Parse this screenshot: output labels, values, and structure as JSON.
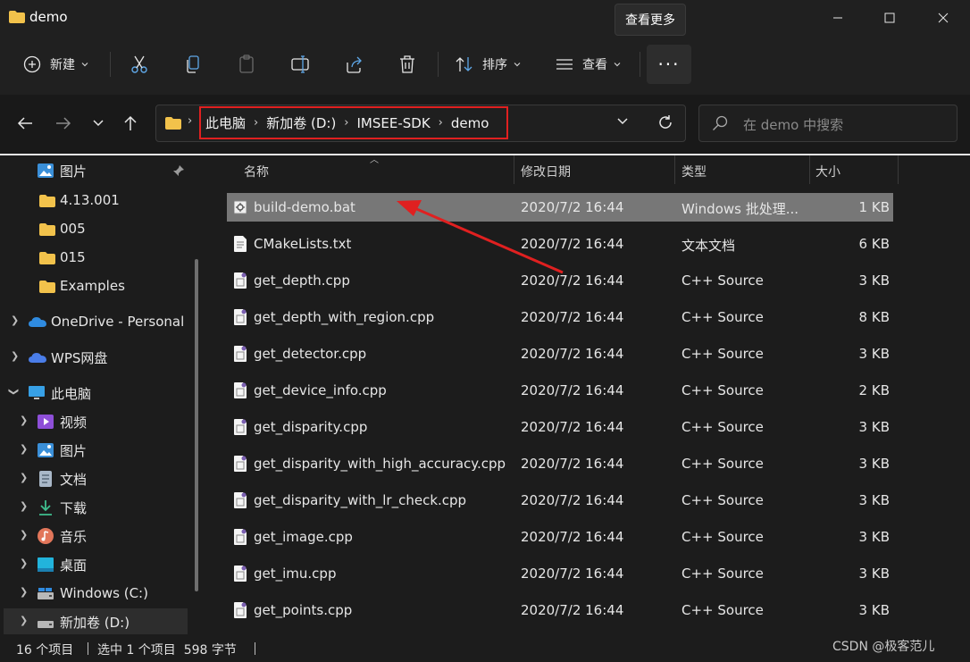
{
  "window": {
    "title": "demo",
    "tooltip": "查看更多"
  },
  "toolbar": {
    "new_label": "新建",
    "sort_label": "排序",
    "view_label": "查看",
    "more_label": "···"
  },
  "address": {
    "crumbs": [
      "此电脑",
      "新加卷 (D:)",
      "IMSEE-SDK",
      "demo"
    ]
  },
  "search": {
    "placeholder": "在 demo 中搜索"
  },
  "sidebar": {
    "items": [
      {
        "label": "图片",
        "icon": "pictures-icon",
        "pinned": true
      },
      {
        "label": "4.13.001",
        "icon": "folder-icon"
      },
      {
        "label": "005",
        "icon": "folder-icon"
      },
      {
        "label": "015",
        "icon": "folder-icon"
      },
      {
        "label": "Examples",
        "icon": "folder-icon"
      },
      {
        "label": "OneDrive - Personal",
        "icon": "onedrive-icon"
      },
      {
        "label": "WPS网盘",
        "icon": "wps-cloud-icon"
      },
      {
        "label": "此电脑",
        "icon": "this-pc-icon"
      },
      {
        "label": "视频",
        "icon": "videos-icon"
      },
      {
        "label": "图片",
        "icon": "pictures-icon"
      },
      {
        "label": "文档",
        "icon": "documents-icon"
      },
      {
        "label": "下载",
        "icon": "downloads-icon"
      },
      {
        "label": "音乐",
        "icon": "music-icon"
      },
      {
        "label": "桌面",
        "icon": "desktop-icon"
      },
      {
        "label": "Windows (C:)",
        "icon": "drive-icon"
      },
      {
        "label": "新加卷 (D:)",
        "icon": "drive-icon"
      }
    ]
  },
  "columns": {
    "name": "名称",
    "date": "修改日期",
    "type": "类型",
    "size": "大小"
  },
  "files": [
    {
      "name": "build-demo.bat",
      "date": "2020/7/2 16:44",
      "type": "Windows 批处理...",
      "size": "1 KB"
    },
    {
      "name": "CMakeLists.txt",
      "date": "2020/7/2 16:44",
      "type": "文本文档",
      "size": "6 KB"
    },
    {
      "name": "get_depth.cpp",
      "date": "2020/7/2 16:44",
      "type": "C++ Source",
      "size": "3 KB"
    },
    {
      "name": "get_depth_with_region.cpp",
      "date": "2020/7/2 16:44",
      "type": "C++ Source",
      "size": "8 KB"
    },
    {
      "name": "get_detector.cpp",
      "date": "2020/7/2 16:44",
      "type": "C++ Source",
      "size": "3 KB"
    },
    {
      "name": "get_device_info.cpp",
      "date": "2020/7/2 16:44",
      "type": "C++ Source",
      "size": "2 KB"
    },
    {
      "name": "get_disparity.cpp",
      "date": "2020/7/2 16:44",
      "type": "C++ Source",
      "size": "3 KB"
    },
    {
      "name": "get_disparity_with_high_accuracy.cpp",
      "date": "2020/7/2 16:44",
      "type": "C++ Source",
      "size": "3 KB"
    },
    {
      "name": "get_disparity_with_lr_check.cpp",
      "date": "2020/7/2 16:44",
      "type": "C++ Source",
      "size": "3 KB"
    },
    {
      "name": "get_image.cpp",
      "date": "2020/7/2 16:44",
      "type": "C++ Source",
      "size": "3 KB"
    },
    {
      "name": "get_imu.cpp",
      "date": "2020/7/2 16:44",
      "type": "C++ Source",
      "size": "3 KB"
    },
    {
      "name": "get_points.cpp",
      "date": "2020/7/2 16:44",
      "type": "C++ Source",
      "size": "3 KB"
    }
  ],
  "status": {
    "count": "16 个项目",
    "selection": "选中 1 个项目  598 字节"
  },
  "watermark": "CSDN @极客范儿"
}
